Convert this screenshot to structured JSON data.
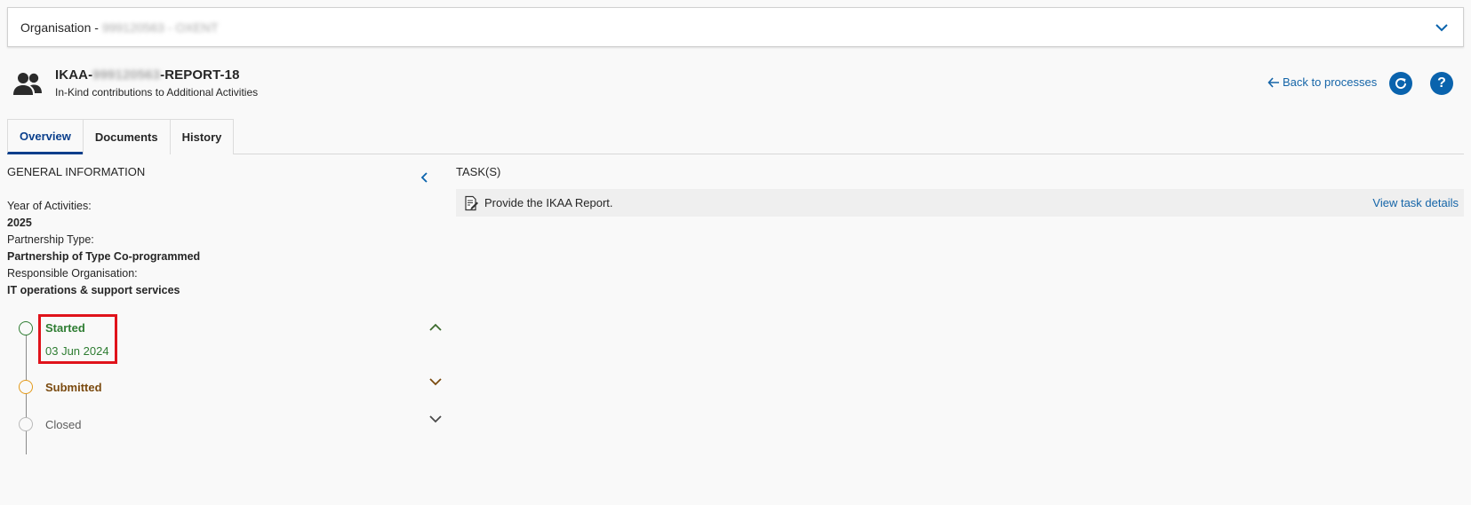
{
  "org_bar": {
    "label_prefix": "Organisation - ",
    "label_masked": "999120563 - OXENT"
  },
  "process": {
    "title_prefix": "IKAA-",
    "title_masked": "999120563",
    "title_suffix": "-REPORT-18",
    "subtitle": "In-Kind contributions to Additional Activities"
  },
  "header_actions": {
    "back_label": "Back to processes",
    "help_label": "?"
  },
  "tabs": [
    {
      "label": "Overview",
      "active": true
    },
    {
      "label": "Documents",
      "active": false
    },
    {
      "label": "History",
      "active": false
    }
  ],
  "general_info": {
    "title": "GENERAL INFORMATION",
    "fields": [
      {
        "label": "Year of Activities:",
        "value": "2025"
      },
      {
        "label": "Partnership Type:",
        "value": "Partnership of Type Co-programmed"
      },
      {
        "label": "Responsible Organisation:",
        "value": "IT operations & support services"
      }
    ]
  },
  "timeline": {
    "steps": [
      {
        "label": "Started",
        "date": "03 Jun 2024",
        "status": "done"
      },
      {
        "label": "Submitted",
        "status": "pending"
      },
      {
        "label": "Closed",
        "status": "inactive"
      }
    ]
  },
  "tasks": {
    "title": "TASK(S)",
    "items": [
      {
        "text": "Provide the IKAA Report.",
        "link": "View task details"
      }
    ]
  },
  "colors": {
    "primary": "#0a63ad",
    "link": "#1565a8",
    "started": "#2e7d32",
    "submitted": "#e39a1b",
    "highlight": "#e0131b"
  }
}
